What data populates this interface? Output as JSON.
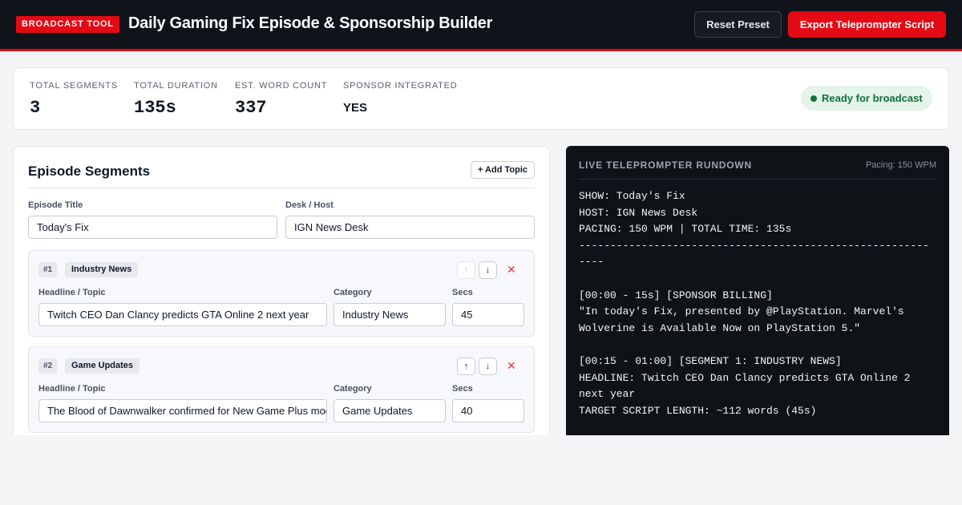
{
  "header": {
    "badge": "BROADCAST TOOL",
    "title": "Daily Gaming Fix Episode & Sponsorship Builder",
    "reset_label": "Reset Preset",
    "export_label": "Export Teleprompter Script"
  },
  "stats": {
    "total_segments_label": "TOTAL SEGMENTS",
    "total_segments": "3",
    "total_duration_label": "TOTAL DURATION",
    "total_duration": "135s",
    "word_count_label": "EST. WORD COUNT",
    "word_count": "337",
    "sponsor_label": "SPONSOR INTEGRATED",
    "sponsor": "YES",
    "status": "Ready for broadcast"
  },
  "editor": {
    "title": "Episode Segments",
    "add_label": "+ Add Topic",
    "episode_title_label": "Episode Title",
    "episode_title": "Today's Fix",
    "host_label": "Desk / Host",
    "host": "IGN News Desk",
    "headline_label": "Headline / Topic",
    "category_label": "Category",
    "secs_label": "Secs",
    "up_icon": "↑",
    "down_icon": "↓",
    "delete_icon": "✕",
    "segments": [
      {
        "num": "#1",
        "category": "Industry News",
        "headline": "Twitch CEO Dan Clancy predicts GTA Online 2 next year",
        "secs": "45"
      },
      {
        "num": "#2",
        "category": "Game Updates",
        "headline": "The Blood of Dawnwalker confirmed for New Game Plus mode",
        "secs": "40"
      }
    ]
  },
  "teleprompter": {
    "title": "LIVE TELEPROMPTER RUNDOWN",
    "pacing": "Pacing: 150 WPM",
    "lines": [
      "SHOW: Today's Fix",
      "HOST: IGN News Desk",
      "PACING: 150 WPM | TOTAL TIME: 135s",
      "--------------------------------------------------------",
      "----",
      "",
      "[00:00 - 15s] [SPONSOR BILLING]",
      "\"In today's Fix, presented by @PlayStation. Marvel's",
      "Wolverine is Available Now on PlayStation 5.\"",
      "",
      "[00:15 - 01:00] [SEGMENT 1: INDUSTRY NEWS]",
      "HEADLINE: Twitch CEO Dan Clancy predicts GTA Online 2",
      "next year",
      "TARGET SCRIPT LENGTH: ~112 words (45s)"
    ]
  },
  "colors": {
    "accent": "#e50914",
    "header_bg": "#10131a",
    "ready_bg": "#e4f4ea",
    "ready_text": "#12703b",
    "teleprompter_bg": "#0f1217"
  }
}
